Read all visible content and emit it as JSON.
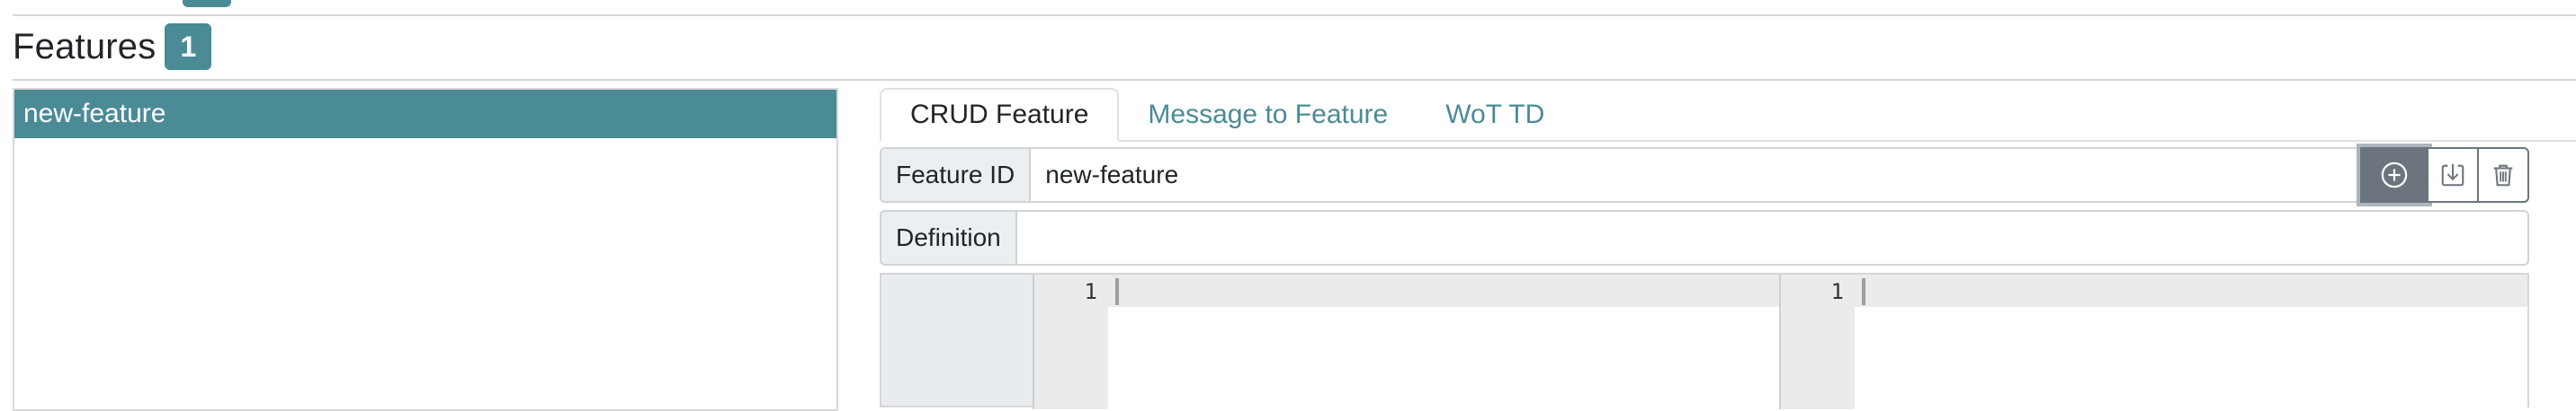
{
  "features": {
    "title": "Features",
    "count": "1",
    "list": [
      "new-feature"
    ]
  },
  "tabs": [
    {
      "label": "CRUD Feature",
      "active": true
    },
    {
      "label": "Message to Feature",
      "active": false
    },
    {
      "label": "WoT TD",
      "active": false
    }
  ],
  "feature_id": {
    "label": "Feature ID",
    "value": "new-feature"
  },
  "definition": {
    "label": "Definition",
    "value": ""
  },
  "buttons": {
    "create_icon": "plus-circle-icon",
    "update_icon": "download-icon",
    "delete_icon": "trash-icon"
  },
  "editors": {
    "left_line": "1",
    "right_line": "1"
  },
  "colors": {
    "accent": "#4a8b96",
    "button_dark": "#6c757d"
  }
}
